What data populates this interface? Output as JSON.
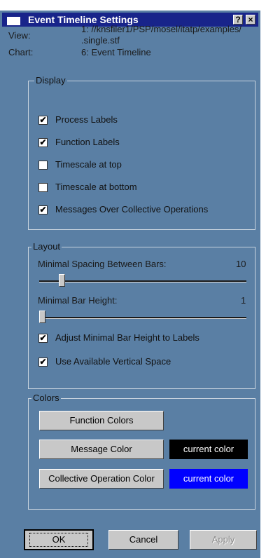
{
  "window": {
    "title": "Event Timeline Settings",
    "help_glyph": "?",
    "close_glyph": "×"
  },
  "info": {
    "view_label": "View:",
    "view_value_line1": "1: //knsfiler1/PSP/mosel/itatp/examples/",
    "view_value_line2": ".single.stf",
    "chart_label": "Chart:",
    "chart_value": "6: Event Timeline"
  },
  "display": {
    "legend": "Display",
    "items": [
      {
        "label": "Process Labels",
        "checked": true
      },
      {
        "label": "Function Labels",
        "checked": true
      },
      {
        "label": "Timescale at top",
        "checked": false
      },
      {
        "label": "Timescale at bottom",
        "checked": false
      },
      {
        "label": "Messages Over Collective Operations",
        "checked": true
      }
    ]
  },
  "layout": {
    "legend": "Layout",
    "spacing": {
      "label": "Minimal Spacing Between Bars:",
      "value": "10"
    },
    "height": {
      "label": "Minimal Bar Height:",
      "value": "1"
    },
    "adjust": {
      "label": "Adjust Minimal Bar Height to Labels",
      "checked": true
    },
    "use_space": {
      "label": "Use Available Vertical Space",
      "checked": true
    }
  },
  "colors": {
    "legend": "Colors",
    "function_button": "Function Colors",
    "message_button": "Message Color",
    "message_swatch": {
      "text": "current color",
      "color": "#000000"
    },
    "collective_button": "Collective Operation Color",
    "collective_swatch": {
      "text": "current color",
      "color": "#0000ff"
    }
  },
  "buttons": {
    "ok": "OK",
    "cancel": "Cancel",
    "apply": "Apply"
  },
  "theme": {
    "window_bg": "#5a7fa4",
    "titlebar_bg": "#18248a",
    "button_face": "#c8c8c8"
  }
}
